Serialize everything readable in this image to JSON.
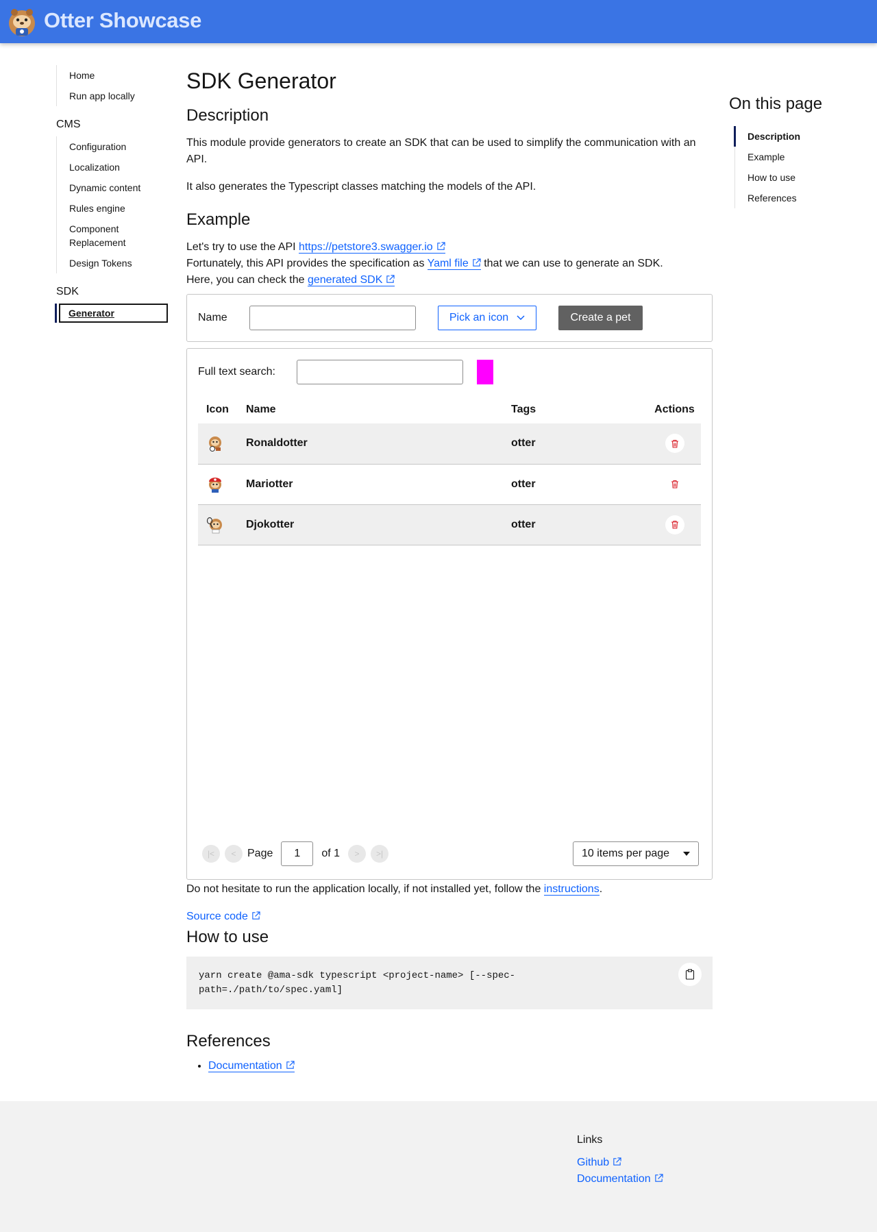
{
  "header": {
    "brand": "Otter Showcase",
    "logo_icon": "otter-logo"
  },
  "sidebar": {
    "top": [
      "Home",
      "Run app locally"
    ],
    "cms_heading": "CMS",
    "cms": [
      "Configuration",
      "Localization",
      "Dynamic content",
      "Rules engine",
      "Component Replacement",
      "Design Tokens"
    ],
    "sdk_heading": "SDK",
    "sdk": [
      "Generator"
    ]
  },
  "toc": {
    "title": "On this page",
    "items": [
      "Description",
      "Example",
      "How to use",
      "References"
    ],
    "active": "Description"
  },
  "main": {
    "title": "SDK Generator",
    "description_heading": "Description",
    "description_p1": "This module provide generators to create an SDK that can be used to simplify the communication with an API.",
    "description_p2": "It also generates the Typescript classes matching the models of the API.",
    "example_heading": "Example",
    "example_l1_pre": "Let's try to use the API ",
    "example_l1_link": "https://petstore3.swagger.io",
    "example_l2_pre": "Fortunately, this API provides the specification as ",
    "example_l2_link": "Yaml file",
    "example_l2_post": " that we can use to generate an SDK.",
    "example_l3_pre": "Here, you can check the ",
    "example_l3_link": "generated SDK",
    "form": {
      "name_label": "Name",
      "name_value": "",
      "pick_icon_label": "Pick an icon",
      "create_label": "Create a pet"
    },
    "search": {
      "label": "Full text search:",
      "value": ""
    },
    "table": {
      "headers": [
        "Icon",
        "Name",
        "Tags",
        "Actions"
      ],
      "rows": [
        {
          "icon": "otter-soccer-icon",
          "name": "Ronaldotter",
          "tags": "otter"
        },
        {
          "icon": "otter-mario-icon",
          "name": "Mariotter",
          "tags": "otter"
        },
        {
          "icon": "otter-tennis-icon",
          "name": "Djokotter",
          "tags": "otter"
        }
      ]
    },
    "pagination": {
      "page_label": "Page",
      "page_value": "1",
      "of_label": "of 1",
      "per_page": "10 items per page"
    },
    "run_locally_pre": "Do not hesitate to run the application locally, if not installed yet, follow the ",
    "run_locally_link": "instructions",
    "run_locally_post": ".",
    "source_code": "Source code",
    "howto_heading": "How to use",
    "code": "yarn create @ama-sdk typescript <project-name> [--spec-path=./path/to/spec.yaml]",
    "references_heading": "References",
    "references": [
      "Documentation"
    ]
  },
  "footer": {
    "heading": "Links",
    "links": [
      "Github",
      "Documentation"
    ]
  },
  "colors": {
    "header": "#3a74e4",
    "link": "#0f62fe",
    "accent": "#ff00ff",
    "delete": "#da1e28"
  }
}
